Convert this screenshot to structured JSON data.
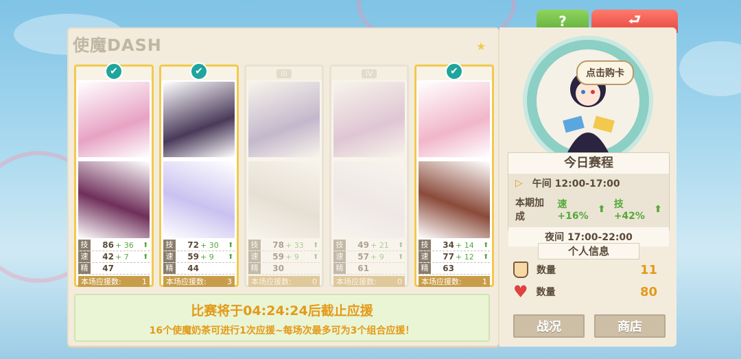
{
  "panel": {
    "title": "使魔DASH"
  },
  "tabs": {
    "help": "?",
    "back": "⮐"
  },
  "cards": [
    {
      "head": "check",
      "roman": "",
      "locked": false,
      "stats": [
        {
          "label": "技",
          "value": "86",
          "bonus": "+ 36"
        },
        {
          "label": "速",
          "value": "42",
          "bonus": "+ 7"
        },
        {
          "label": "精",
          "value": "47",
          "bonus": ""
        }
      ],
      "support_label": "本场应援数:",
      "support": "1",
      "colors": [
        "#e7a2c4",
        "#6f2f5a"
      ]
    },
    {
      "head": "check",
      "roman": "",
      "locked": false,
      "stats": [
        {
          "label": "技",
          "value": "72",
          "bonus": "+ 30"
        },
        {
          "label": "速",
          "value": "59",
          "bonus": "+ 9"
        },
        {
          "label": "精",
          "value": "44",
          "bonus": ""
        }
      ],
      "support_label": "本场应援数:",
      "support": "3",
      "colors": [
        "#4a3a5a",
        "#c9c2f0"
      ]
    },
    {
      "head": "",
      "roman": "III",
      "locked": true,
      "stats": [
        {
          "label": "技",
          "value": "78",
          "bonus": "+ 33"
        },
        {
          "label": "速",
          "value": "59",
          "bonus": "+ 9"
        },
        {
          "label": "精",
          "value": "30",
          "bonus": ""
        }
      ],
      "support_label": "本场应援数:",
      "support": "0",
      "colors": [
        "#8a7ab8",
        "#d7d0c9"
      ]
    },
    {
      "head": "",
      "roman": "IV",
      "locked": true,
      "stats": [
        {
          "label": "技",
          "value": "49",
          "bonus": "+ 21"
        },
        {
          "label": "速",
          "value": "57",
          "bonus": "+ 9"
        },
        {
          "label": "精",
          "value": "61",
          "bonus": ""
        }
      ],
      "support_label": "本场应援数:",
      "support": "0",
      "colors": [
        "#c79ac9",
        "#e9e3f3"
      ]
    },
    {
      "head": "check",
      "roman": "",
      "locked": false,
      "stats": [
        {
          "label": "技",
          "value": "34",
          "bonus": "+ 14"
        },
        {
          "label": "速",
          "value": "77",
          "bonus": "+ 12"
        },
        {
          "label": "精",
          "value": "63",
          "bonus": ""
        }
      ],
      "support_label": "本场应援数:",
      "support": "1",
      "colors": [
        "#f1b6c9",
        "#8a4a3a"
      ]
    }
  ],
  "banner": {
    "main": "比赛将于04:24:24后截止应援",
    "sub": "16个使魔奶茶可进行1次应援~每场次最多可为3个组合应援！"
  },
  "side": {
    "buy_label": "点击购卡",
    "schedule_title": "今日赛程",
    "noon": "午间 12:00-17:00",
    "bonus_label": "本期加成",
    "bonus_speed": "速+16%",
    "bonus_skill": "技+42%",
    "night": "夜间 17:00-22:00",
    "info_title": "个人信息",
    "tea_label": "数量",
    "tea_value": "11",
    "heart_label": "数量",
    "heart_value": "80",
    "battle_btn": "战况",
    "shop_btn": "商店"
  }
}
